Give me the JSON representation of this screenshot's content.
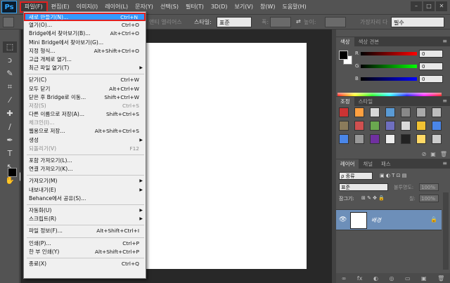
{
  "app": {
    "logo": "Ps"
  },
  "menubar": {
    "items": [
      {
        "label": "파일(F)",
        "active": true
      },
      {
        "label": "편집(E)"
      },
      {
        "label": "이미지(I)"
      },
      {
        "label": "레이어(L)"
      },
      {
        "label": "문자(Y)"
      },
      {
        "label": "선택(S)"
      },
      {
        "label": "필터(T)"
      },
      {
        "label": "3D(D)"
      },
      {
        "label": "보기(V)"
      },
      {
        "label": "창(W)"
      },
      {
        "label": "도움말(H)"
      }
    ],
    "window_buttons": [
      "–",
      "□",
      "✕"
    ]
  },
  "options_bar": {
    "antialias_label": "앤티 앨리어스",
    "style_label": "스타일:",
    "style_value": "표준",
    "width_label": "폭:",
    "height_label": "높이:",
    "workspace_value": "필수",
    "workspace_label_dim": "가장자리 다"
  },
  "file_menu": {
    "items": [
      {
        "label": "새로 만들기(N)...",
        "shortcut": "Ctrl+N",
        "highlight": true
      },
      {
        "label": "열기(O)...",
        "shortcut": "Ctrl+O"
      },
      {
        "label": "Bridge에서 찾아보기(B)...",
        "shortcut": "Alt+Ctrl+O"
      },
      {
        "label": "Mini Bridge에서 찾아보기(G)..."
      },
      {
        "label": "지정 형식...",
        "shortcut": "Alt+Shift+Ctrl+O"
      },
      {
        "label": "고급 개체로 열기..."
      },
      {
        "label": "최근 파일 열기(T)",
        "submenu": true
      },
      {
        "sep": true
      },
      {
        "label": "닫기(C)",
        "shortcut": "Ctrl+W"
      },
      {
        "label": "모두 닫기",
        "shortcut": "Alt+Ctrl+W"
      },
      {
        "label": "닫은 후 Bridge로 이동...",
        "shortcut": "Shift+Ctrl+W"
      },
      {
        "label": "저장(S)",
        "shortcut": "Ctrl+S",
        "disabled": true
      },
      {
        "label": "다른 이름으로 저장(A)...",
        "shortcut": "Shift+Ctrl+S"
      },
      {
        "label": "체크인(I)...",
        "disabled": true
      },
      {
        "label": "웹용으로 저장...",
        "shortcut": "Alt+Shift+Ctrl+S"
      },
      {
        "label": "생성",
        "submenu": true
      },
      {
        "label": "되돌리기(V)",
        "shortcut": "F12",
        "disabled": true
      },
      {
        "sep": true
      },
      {
        "label": "포함 가져오기(L)..."
      },
      {
        "label": "연결 가져오기(K)..."
      },
      {
        "sep": true
      },
      {
        "label": "가져오기(M)",
        "submenu": true
      },
      {
        "label": "내보내기(E)",
        "submenu": true
      },
      {
        "label": "Behance에서 공유(S)..."
      },
      {
        "sep": true
      },
      {
        "label": "자동화(U)",
        "submenu": true
      },
      {
        "label": "스크립트(R)",
        "submenu": true
      },
      {
        "sep": true
      },
      {
        "label": "파일 정보(F)...",
        "shortcut": "Alt+Shift+Ctrl+I"
      },
      {
        "sep": true
      },
      {
        "label": "인쇄(P)...",
        "shortcut": "Ctrl+P"
      },
      {
        "label": "한 부 인쇄(Y)",
        "shortcut": "Alt+Shift+Ctrl+P"
      },
      {
        "sep": true
      },
      {
        "label": "종료(X)",
        "shortcut": "Ctrl+Q"
      }
    ]
  },
  "color_panel": {
    "tabs": [
      "색상",
      "색상 견본"
    ],
    "r_label": "R",
    "g_label": "G",
    "b_label": "B",
    "r_value": "0",
    "g_value": "0",
    "b_value": "0"
  },
  "adjust_panel": {
    "tabs": [
      "조정",
      "스타일"
    ],
    "icon_colors": [
      "#cc3333",
      "#ffa040",
      "#d8d8d8",
      "#5a9bd5",
      "#888888",
      "#aaaaaa",
      "#bdbdbd",
      "#8b7b5b",
      "#d05050",
      "#6aa84f",
      "#6f6fc0",
      "#d9d9d9",
      "#f1c232",
      "#4a86e8",
      "#4a86e8",
      "#999999",
      "#7030a0",
      "#eeeeee",
      "#222222",
      "#ffd966",
      "#cccccc"
    ]
  },
  "layers_panel": {
    "tabs": [
      "레이어",
      "채널",
      "패스"
    ],
    "filter_label": "ρ 종류",
    "blend_mode": "표준",
    "opacity_label": "불투명도:",
    "opacity_value": "100%",
    "lock_label": "잠그기:",
    "fill_label": "칠:",
    "fill_value": "100%",
    "layer_name": "배경",
    "footer_icons": [
      "∞",
      "fx",
      "◐",
      "◎",
      "▭",
      "▣",
      "🗑"
    ]
  }
}
